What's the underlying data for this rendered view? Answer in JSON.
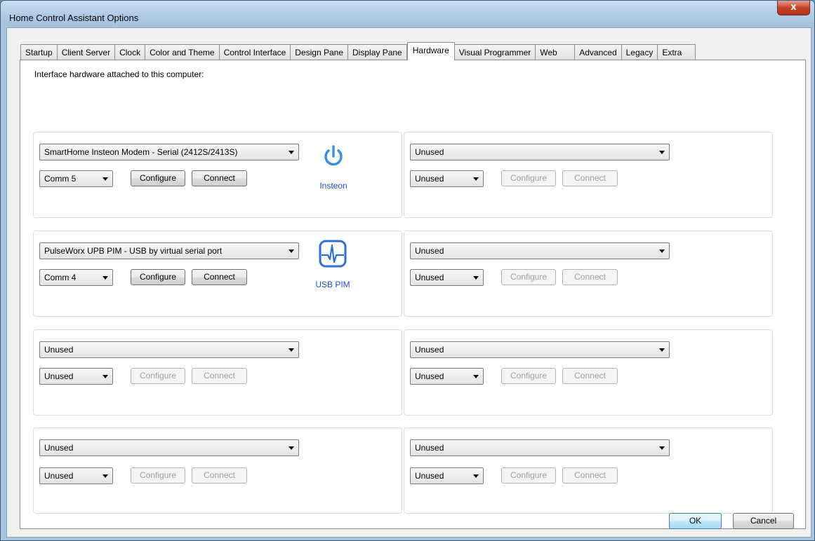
{
  "window": {
    "title": "Home Control Assistant Options",
    "close_glyph": "x"
  },
  "tabs": [
    "Startup",
    "Client Server",
    "Clock",
    "Color and Theme",
    "Control Interface",
    "Design Pane",
    "Display Pane",
    "Hardware",
    "Visual Programmer",
    "Web",
    "Advanced",
    "Legacy",
    "Extra"
  ],
  "active_tab": "Hardware",
  "hardware": {
    "intro": "Interface hardware attached to this computer:",
    "slots": [
      {
        "device": "SmartHome Insteon Modem - Serial (2412S/2413S)",
        "port": "Comm 5",
        "configure": "Configure",
        "connect": "Connect",
        "enabled": true,
        "icon": "power-icon",
        "icon_label": "Insteon"
      },
      {
        "device": "Unused",
        "port": "Unused",
        "configure": "Configure",
        "connect": "Connect",
        "enabled": false
      },
      {
        "device": "PulseWorx UPB PIM - USB by virtual serial port",
        "port": "Comm 4",
        "configure": "Configure",
        "connect": "Connect",
        "enabled": true,
        "icon": "usb-pim-icon",
        "icon_label": "USB PIM"
      },
      {
        "device": "Unused",
        "port": "Unused",
        "configure": "Configure",
        "connect": "Connect",
        "enabled": false
      },
      {
        "device": "Unused",
        "port": "Unused",
        "configure": "Configure",
        "connect": "Connect",
        "enabled": false
      },
      {
        "device": "Unused",
        "port": "Unused",
        "configure": "Configure",
        "connect": "Connect",
        "enabled": false
      },
      {
        "device": "Unused",
        "port": "Unused",
        "configure": "Configure",
        "connect": "Connect",
        "enabled": false
      },
      {
        "device": "Unused",
        "port": "Unused",
        "configure": "Configure",
        "connect": "Connect",
        "enabled": false
      }
    ]
  },
  "footer": {
    "ok": "OK",
    "cancel": "Cancel"
  },
  "colors": {
    "icon_blue": "#3d8ee0",
    "label_blue": "#1f4fd6"
  }
}
